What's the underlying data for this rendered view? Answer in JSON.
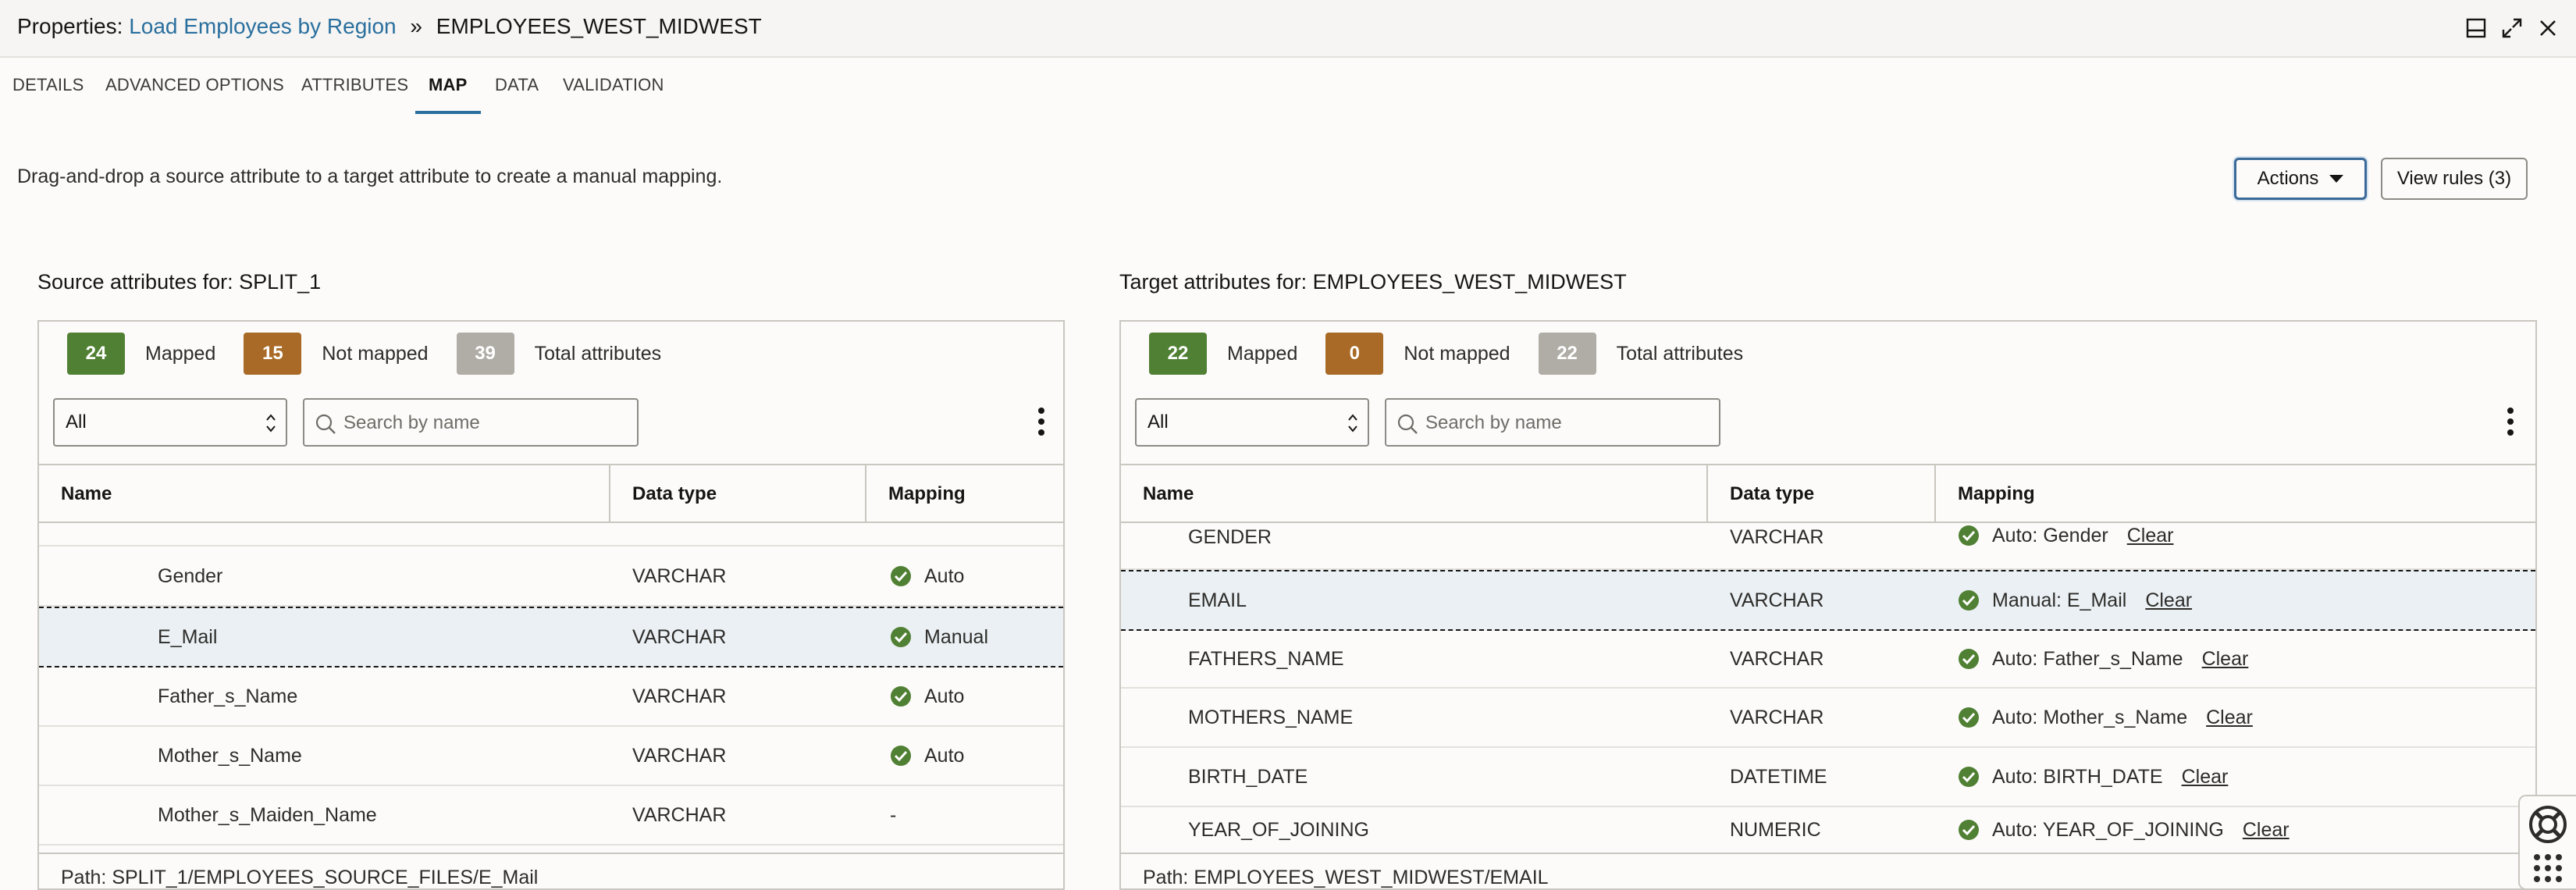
{
  "titlebar": {
    "prefix": "Properties:",
    "link": "Load Employees by Region",
    "separator": "»",
    "current": "EMPLOYEES_WEST_MIDWEST"
  },
  "tabs": [
    "DETAILS",
    "ADVANCED OPTIONS",
    "ATTRIBUTES",
    "MAP",
    "DATA",
    "VALIDATION"
  ],
  "active_tab": "MAP",
  "instruction": "Drag-and-drop a source attribute to a target attribute to create a manual mapping.",
  "buttons": {
    "actions": "Actions",
    "view_rules": "View rules (3)"
  },
  "source": {
    "heading": "Source attributes for: SPLIT_1",
    "mapped_count": "24",
    "mapped_label": "Mapped",
    "not_mapped_count": "15",
    "not_mapped_label": "Not mapped",
    "total_count": "39",
    "total_label": "Total attributes",
    "filter_value": "All",
    "search_placeholder": "Search by name",
    "columns": {
      "name": "Name",
      "datatype": "Data type",
      "mapping": "Mapping"
    },
    "rows": [
      {
        "name": "Gender",
        "datatype": "VARCHAR",
        "mapping": "Auto",
        "mapped": true
      },
      {
        "name": "E_Mail",
        "datatype": "VARCHAR",
        "mapping": "Manual",
        "mapped": true
      },
      {
        "name": "Father_s_Name",
        "datatype": "VARCHAR",
        "mapping": "Auto",
        "mapped": true
      },
      {
        "name": "Mother_s_Name",
        "datatype": "VARCHAR",
        "mapping": "Auto",
        "mapped": true
      },
      {
        "name": "Mother_s_Maiden_Name",
        "datatype": "VARCHAR",
        "mapping": "-",
        "mapped": false
      }
    ],
    "path": "Path: SPLIT_1/EMPLOYEES_SOURCE_FILES/E_Mail"
  },
  "target": {
    "heading": "Target attributes for: EMPLOYEES_WEST_MIDWEST",
    "mapped_count": "22",
    "mapped_label": "Mapped",
    "not_mapped_count": "0",
    "not_mapped_label": "Not mapped",
    "total_count": "22",
    "total_label": "Total attributes",
    "filter_value": "All",
    "search_placeholder": "Search by name",
    "columns": {
      "name": "Name",
      "datatype": "Data type",
      "mapping": "Mapping"
    },
    "clear_label": "Clear",
    "rows": [
      {
        "name": "GENDER",
        "datatype": "VARCHAR",
        "mapping": "Auto: Gender"
      },
      {
        "name": "EMAIL",
        "datatype": "VARCHAR",
        "mapping": "Manual: E_Mail"
      },
      {
        "name": "FATHERS_NAME",
        "datatype": "VARCHAR",
        "mapping": "Auto: Father_s_Name"
      },
      {
        "name": "MOTHERS_NAME",
        "datatype": "VARCHAR",
        "mapping": "Auto: Mother_s_Name"
      },
      {
        "name": "BIRTH_DATE",
        "datatype": "DATETIME",
        "mapping": "Auto: BIRTH_DATE"
      },
      {
        "name": "YEAR_OF_JOINING",
        "datatype": "NUMERIC",
        "mapping": "Auto: YEAR_OF_JOINING"
      }
    ],
    "path": "Path: EMPLOYEES_WEST_MIDWEST/EMAIL"
  },
  "colors": {
    "accent": "#2a6f9e",
    "mapped_green": "#508033",
    "not_mapped_brown": "#a86a26",
    "total_gray": "#b0aca6"
  },
  "icons": [
    "restore-icon",
    "expand-icon",
    "close-icon",
    "search-icon",
    "kebab-icon",
    "check-circle-icon",
    "help-lifebuoy-icon",
    "grid-icon"
  ]
}
